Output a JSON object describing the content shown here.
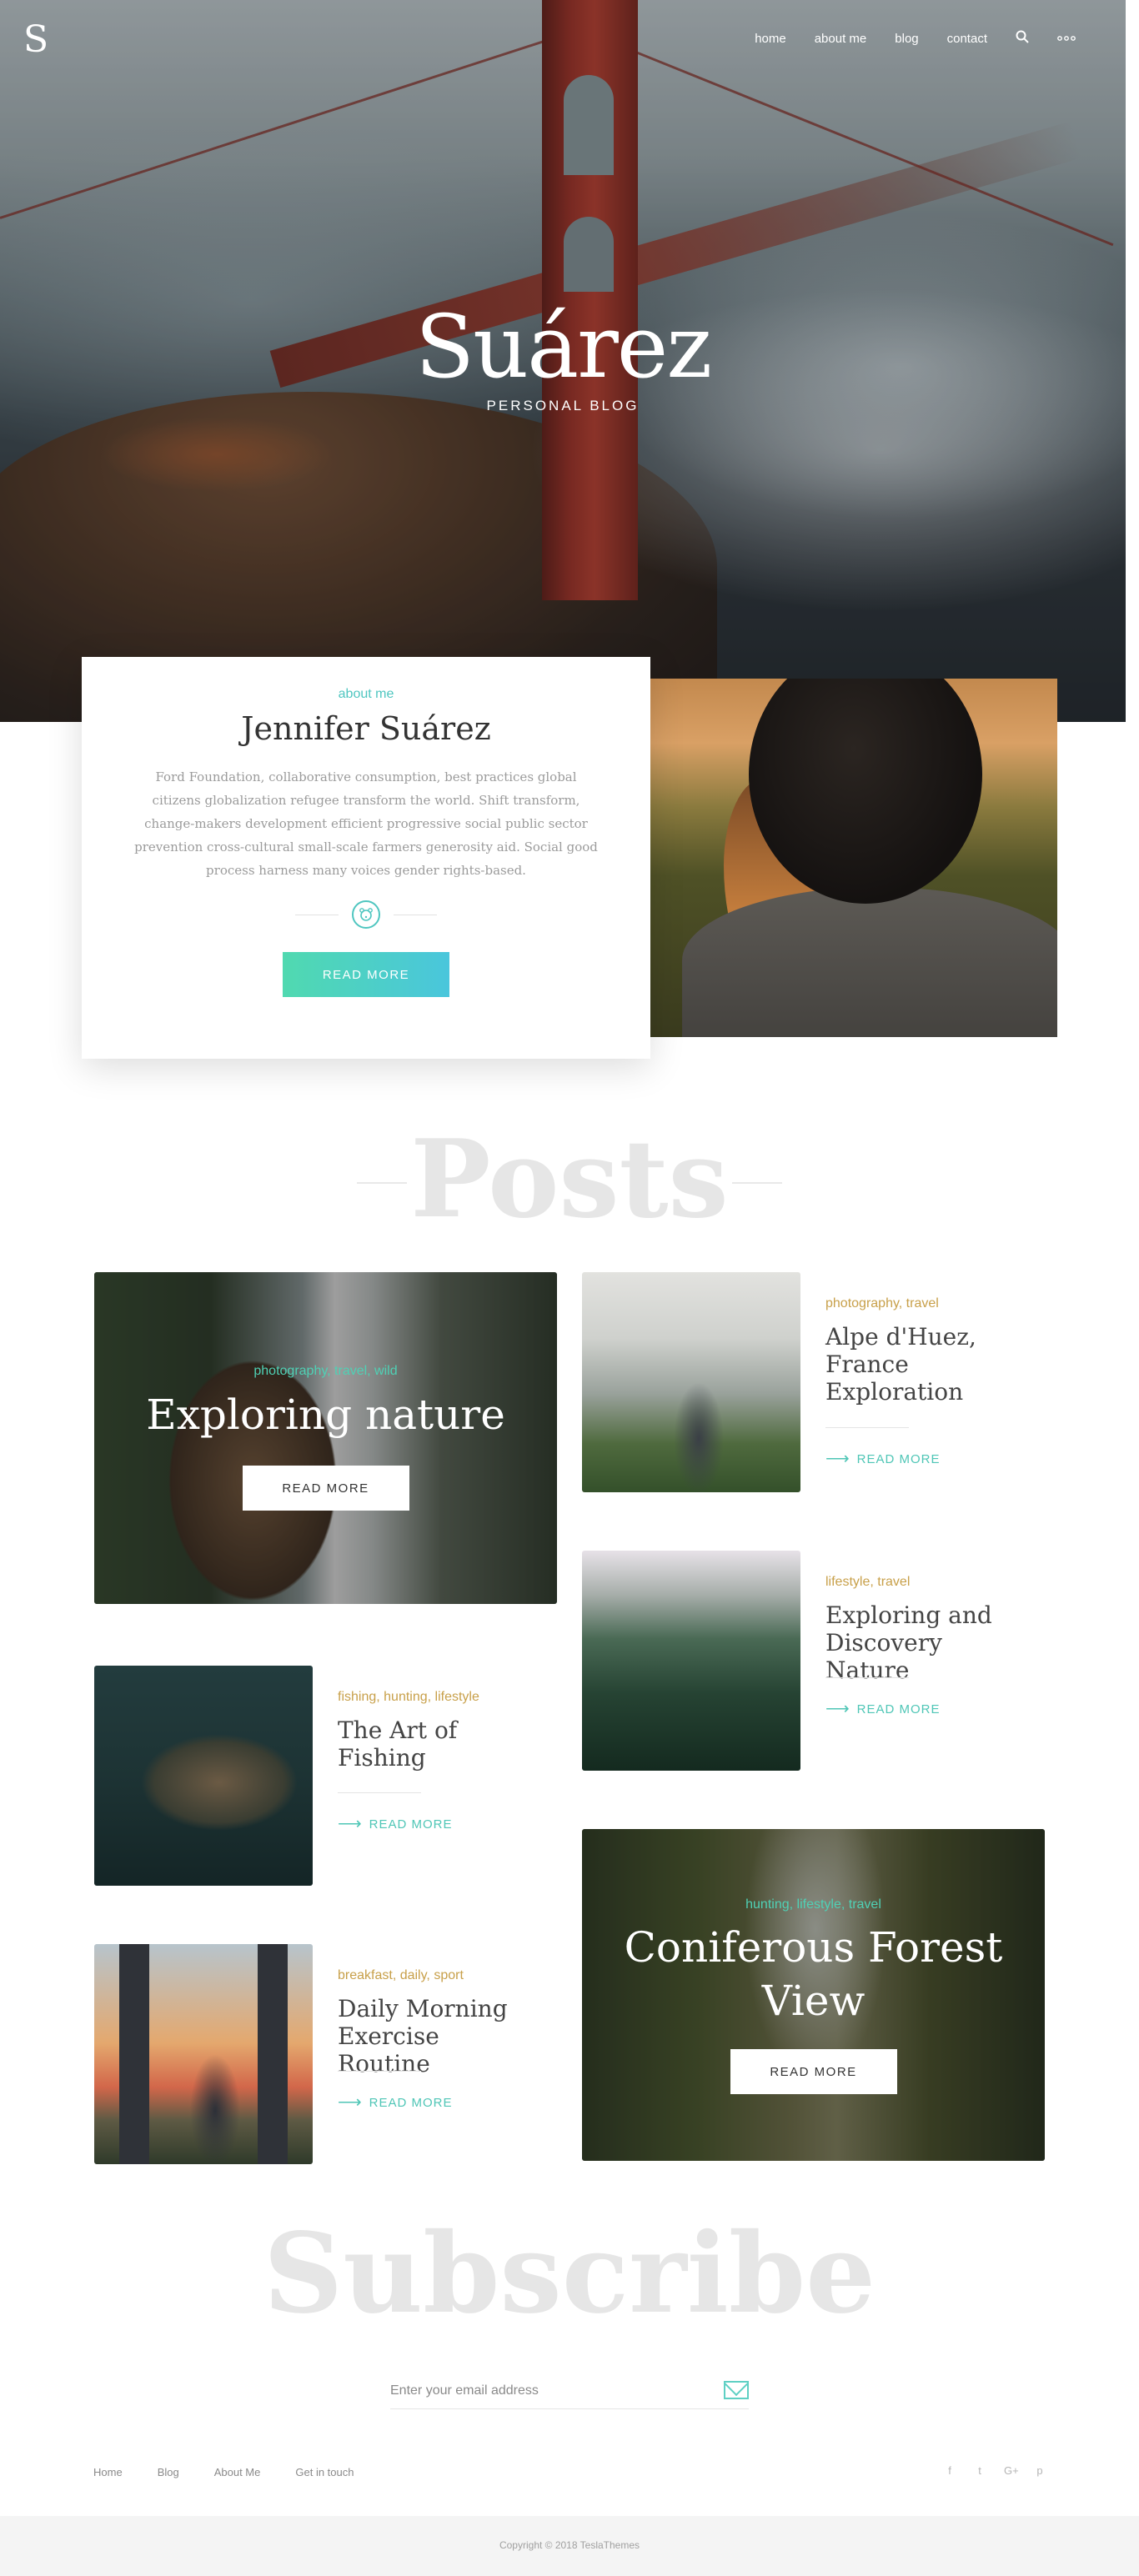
{
  "brand": {
    "logo": "S"
  },
  "nav": {
    "items": [
      "home",
      "about me",
      "blog",
      "contact"
    ],
    "search_icon": "search-icon",
    "more_icon": "more-dots-icon"
  },
  "hero": {
    "title": "Suárez",
    "subtitle": "PERSONAL BLOG"
  },
  "about": {
    "label": "about me",
    "name": "Jennifer Suárez",
    "text": "Ford Foundation, collaborative consumption, best practices global citizens globalization refugee transform the world. Shift transform, change-makers development efficient progressive social public sector prevention cross-cultural small-scale farmers generosity aid. Social good process harness many voices gender rights-based.",
    "badge_icon": "bear-icon",
    "button": "READ MORE"
  },
  "posts": {
    "heading": "Posts",
    "items": [
      {
        "categories": "photography, travel, wild",
        "title": "Exploring nature",
        "button": "READ MORE"
      },
      {
        "categories": "photography, travel",
        "title": "Alpe d'Huez, France Exploration",
        "more": "READ MORE"
      },
      {
        "categories": "lifestyle, travel",
        "title": "Exploring and Discovery Nature",
        "more": "READ MORE"
      },
      {
        "categories": "fishing, hunting, lifestyle",
        "title": "The Art of Fishing",
        "more": "READ MORE"
      },
      {
        "categories": "hunting, lifestyle, travel",
        "title": "Coniferous Forest View",
        "button": "READ MORE"
      },
      {
        "categories": "breakfast, daily, sport",
        "title": "Daily Morning Exercise Routine",
        "more": "READ MORE"
      }
    ]
  },
  "subscribe": {
    "heading": "Subscribe",
    "placeholder": "Enter your email address",
    "icon": "envelope-icon"
  },
  "footer": {
    "nav": [
      "Home",
      "Blog",
      "About Me",
      "Get in touch"
    ],
    "social": [
      "f",
      "t",
      "G+",
      "p"
    ],
    "copyright": "Copyright © 2018 TeslaThemes"
  },
  "colors": {
    "accent": "#4fc6c0",
    "accent_gradient_start": "#50d9b0",
    "accent_gradient_end": "#4ac6dc",
    "category_gold": "#c8a04a",
    "heading_ghost": "#e6e6e6"
  }
}
